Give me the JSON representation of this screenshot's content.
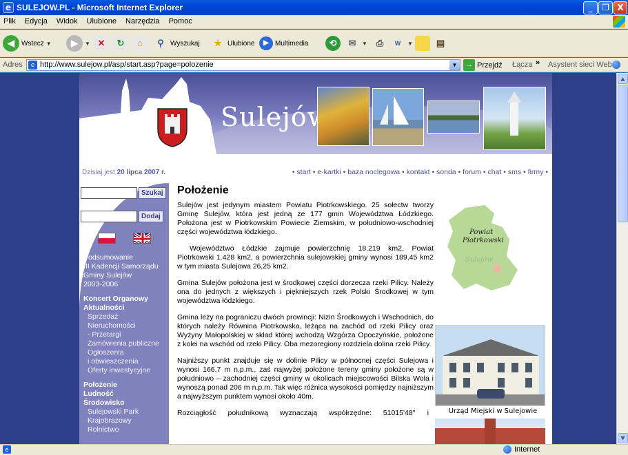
{
  "window": {
    "title": "SULEJOW.PL - Microsoft Internet Explorer",
    "buttons": {
      "minimize": "_",
      "maximize": "❐",
      "close": "X"
    }
  },
  "menubar": [
    "Plik",
    "Edycja",
    "Widok",
    "Ulubione",
    "Narzędzia",
    "Pomoc"
  ],
  "toolbar": {
    "back": "Wstecz",
    "search": "Wyszukaj",
    "favorites": "Ulubione",
    "media": "Multimedia"
  },
  "address": {
    "label": "Adres",
    "url": "http://www.sulejow.pl/asp/start.asp?page=polozenie",
    "go": "Przejdź",
    "links": "Łącza",
    "chevron": "»",
    "assistant": "Asystent sieci Web"
  },
  "site": {
    "title": "Sulejów",
    "date_prefix": "Dzisiaj jest",
    "date_value": "20 lipca 2007 r.",
    "nav": [
      "start",
      "e-kartki",
      "baza noclegowa",
      "kontakt",
      "sonda",
      "forum",
      "chat",
      "sms",
      "firmy"
    ],
    "search_button": "Szukaj",
    "add_button": "Dodaj",
    "menu": [
      {
        "text": "Podsumowanie",
        "style": "plain"
      },
      {
        "text": "III Kadencji Samorządu",
        "style": "plain"
      },
      {
        "text": "Gminy Sulejów",
        "style": "plain"
      },
      {
        "text": "2003-2006",
        "style": "plain"
      },
      {
        "text": "",
        "style": "gap"
      },
      {
        "text": "Koncert Organowy",
        "style": "bold"
      },
      {
        "text": "Aktualności",
        "style": "bold"
      },
      {
        "text": "Sprzedaż",
        "style": "sub"
      },
      {
        "text": "Nieruchomości",
        "style": "sub"
      },
      {
        "text": "- Przetargi",
        "style": "sub"
      },
      {
        "text": "Zamówienia publiczne",
        "style": "sub"
      },
      {
        "text": "Ogłoszenia",
        "style": "sub"
      },
      {
        "text": "i obwieszczenia",
        "style": "sub"
      },
      {
        "text": "Oferty inwestycyjne",
        "style": "sub"
      },
      {
        "text": "",
        "style": "gap"
      },
      {
        "text": "Położenie",
        "style": "bold"
      },
      {
        "text": "Ludność",
        "style": "bold"
      },
      {
        "text": "Środowisko",
        "style": "bold"
      },
      {
        "text": "Sulejowski Park",
        "style": "sub"
      },
      {
        "text": "Krajobrazowy",
        "style": "sub"
      },
      {
        "text": "Rolnictwo",
        "style": "sub"
      }
    ],
    "heading": "Położenie",
    "paragraphs": [
      "Sulejów jest jedynym miastem Powiatu Piotrkowskiego. 25 sołectw tworzy Gminę Sulejów, która jest jedną ze 177 gmin Województwa Łódzkiego. Położona jest w Piotrkowskim Powiecie Ziemskim, w południowo-wschodniej części województwa łódzkiego.",
      "Województwo Łódzkie zajmuje powierzchnię 18.219 km2, Powiat Piotrkowski 1.428 km2, a powierzchnia sulejowskiej gminy wynosi 189,45 km2 w tym miasta Sulejowa 26,25 km2.",
      "Gmina Sulejów położona jest w środkowej części dorzecza rzeki Pilicy. Należy ona do jednych z większych i piękniejszych rzek Polski Środkowej w tym województwa łódzkiego.",
      "Gmina leży na pograniczu dwóch prowincji: Nizin Środkowych i Wschodnich, do których należy Równina Piotrkowska, leżąca na zachód od rzeki Pilicy oraz Wyżyny Małopolskiej w skład której wchodzą Wzgórza Opoczyńskie, położone z kolei na wschód od rzeki Pilicy. Oba mezoregiony rozdziela dolina rzeki Pilicy.",
      "Najniższy punkt znajduje się w dolinie Pilicy w północnej części Sulejowa i wynosi 166,7 m n.p.m., zaś najwyżej położone tereny gminy położone są w południowo – zachodniej części gminy w okolicach miejscowości Bilska Wola i wynoszą ponad 206 m n.p.m. Tak więc różnica wysokości pomiędzy najniższym a najwyższym punktem wynosi około 40m.",
      "Rozciągłość południkową wyznaczają współrzędne: 51015'48'' i"
    ],
    "map_label_1": "Powiat",
    "map_label_2": "Piotrkowski",
    "map_town": "Sulejów",
    "photo_caption": "Urząd Miejski w Sulejowie"
  },
  "status": {
    "zone": "Internet"
  }
}
